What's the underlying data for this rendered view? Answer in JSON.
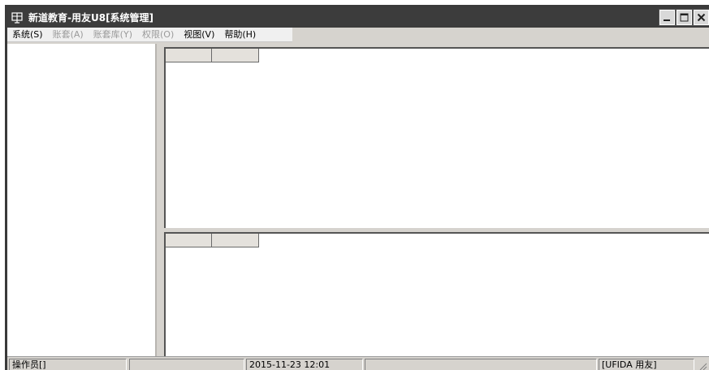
{
  "window": {
    "title": "新道教育-用友U8[系统管理]"
  },
  "icons": {
    "app": "app-icon",
    "minimize": "minimize-icon",
    "maximize": "maximize-icon",
    "close": "close-icon",
    "resize_grip": "resize-grip-icon"
  },
  "menu": {
    "items": [
      {
        "label": "系统(S)",
        "enabled": true
      },
      {
        "label": "账套(A)",
        "enabled": false
      },
      {
        "label": "账套库(Y)",
        "enabled": false
      },
      {
        "label": "权限(O)",
        "enabled": false
      },
      {
        "label": "视图(V)",
        "enabled": true
      },
      {
        "label": "帮助(H)",
        "enabled": true
      }
    ]
  },
  "status": {
    "operator": "操作员[]",
    "empty1": "",
    "datetime": "2015-11-23 12:01",
    "empty2": "",
    "vendor": "[UFIDA 用友]"
  },
  "colors": {
    "titlebar": "#3c3c3c",
    "frame": "#d6d3ce",
    "menubar": "#f0f0f0",
    "disabled_text": "#9a9a9a"
  }
}
